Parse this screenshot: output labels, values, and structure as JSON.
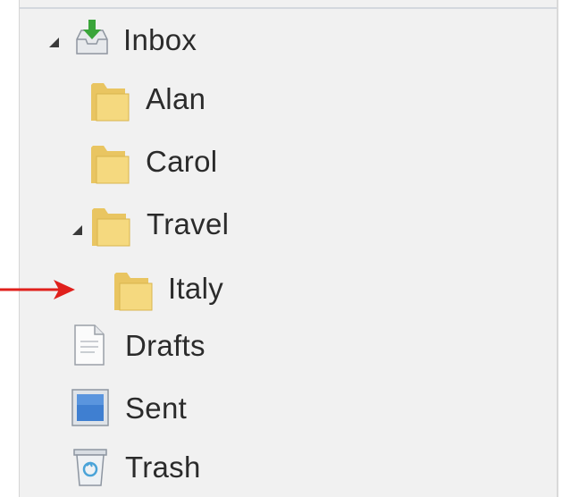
{
  "folder_tree": {
    "items": [
      {
        "label": "Inbox",
        "icon": "inbox-icon",
        "expanded": true
      },
      {
        "label": "Alan",
        "icon": "folder-icon"
      },
      {
        "label": "Carol",
        "icon": "folder-icon"
      },
      {
        "label": "Travel",
        "icon": "folder-icon",
        "expanded": true
      },
      {
        "label": "Italy",
        "icon": "folder-icon"
      },
      {
        "label": "Drafts",
        "icon": "drafts-icon"
      },
      {
        "label": "Sent",
        "icon": "sent-icon"
      },
      {
        "label": "Trash",
        "icon": "trash-icon"
      }
    ]
  },
  "annotation": {
    "arrow_color": "#e0201c",
    "points_to": "Italy"
  },
  "colors": {
    "pane_background": "#f1f1f1",
    "folder_yellow": "#f3d27a",
    "text": "#2b2b2b"
  }
}
